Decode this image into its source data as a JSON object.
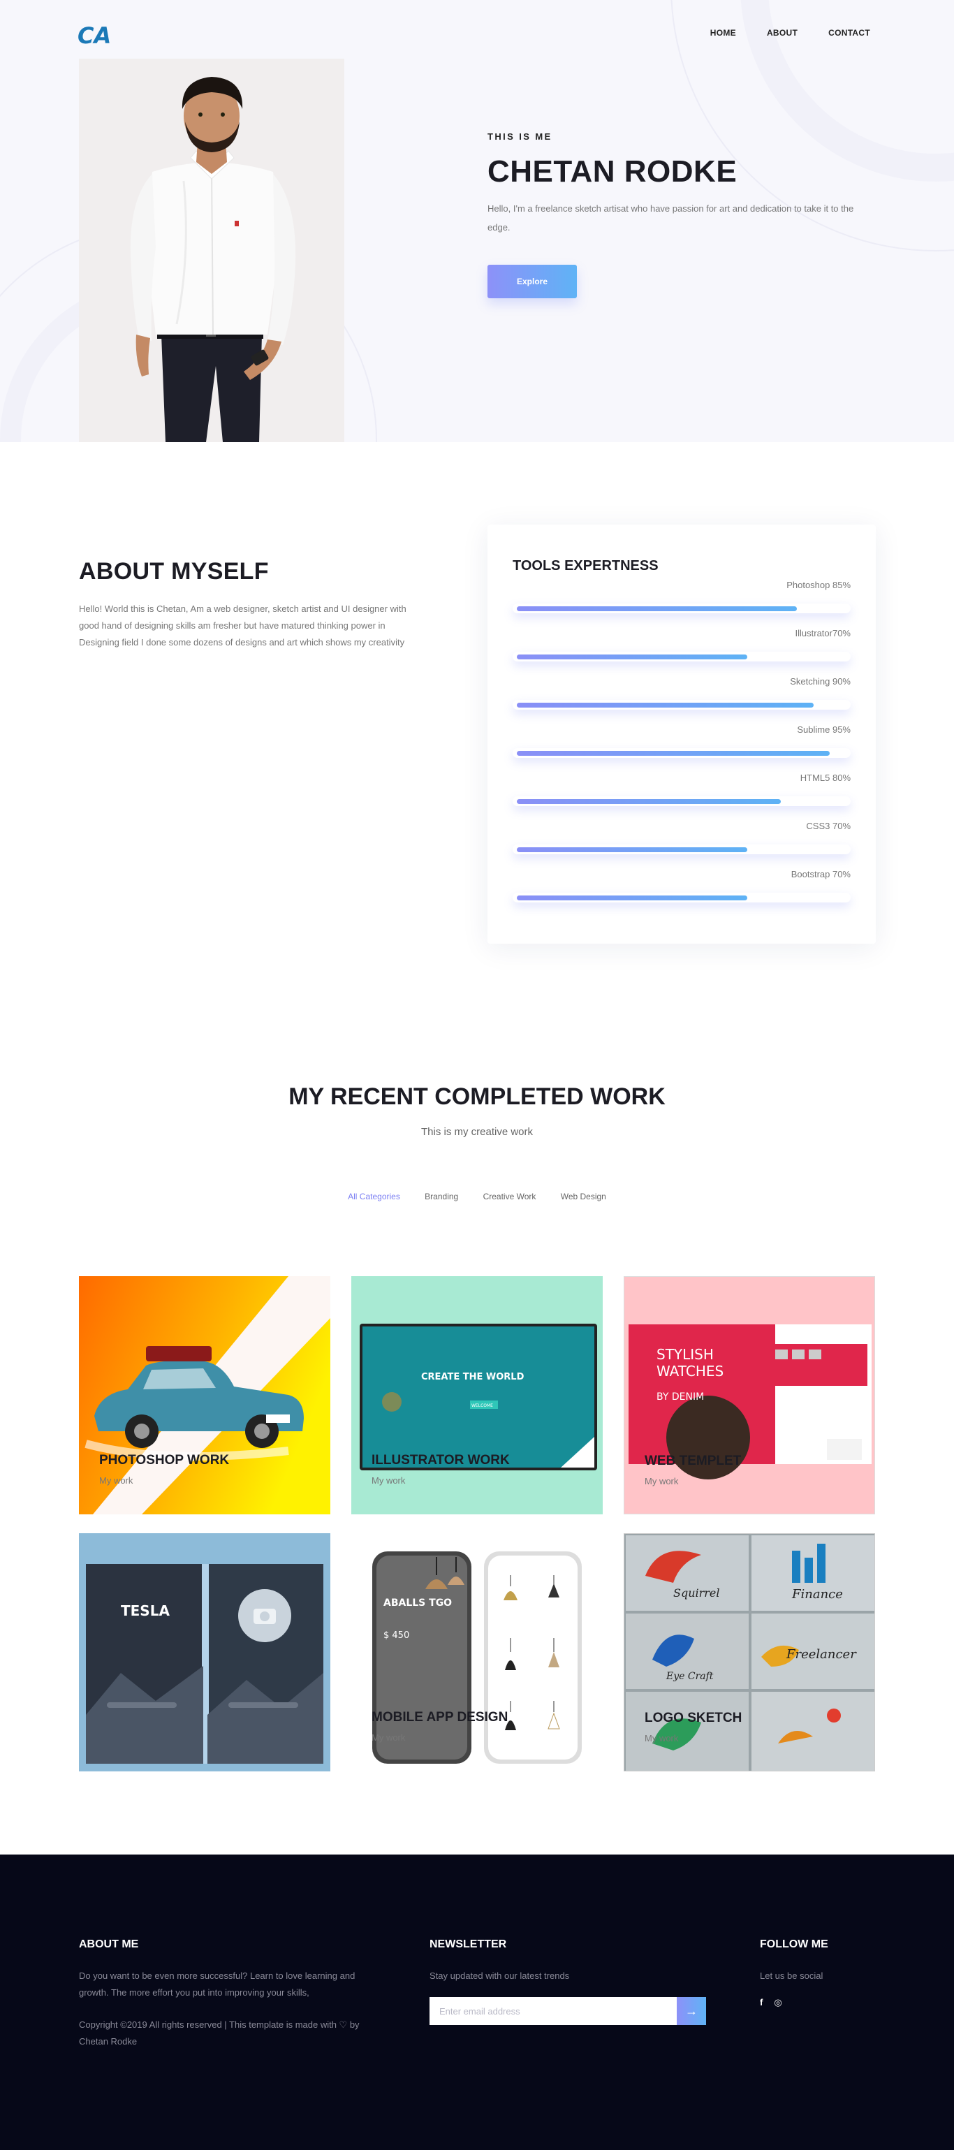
{
  "nav": {
    "logo_text": "CA",
    "items": [
      {
        "label": "HOME"
      },
      {
        "label": "ABOUT"
      },
      {
        "label": "CONTACT"
      }
    ]
  },
  "hero": {
    "eyebrow": "THIS IS ME",
    "title": "CHETAN RODKE",
    "description": "Hello, I'm a freelance sketch artisat who have passion for art and dedication to take it to the edge.",
    "button_label": "Explore"
  },
  "about": {
    "title": "ABOUT MYSELF",
    "description": "Hello! World this is Chetan, Am a web designer, sketch artist and UI designer with good hand of designing skills am fresher but have matured thinking power in Designing field I done some dozens of designs and art which shows my creativity"
  },
  "tools": {
    "title": "TOOLS EXPERTNESS",
    "skills": [
      {
        "label": "Photoshop 85%",
        "value": 85
      },
      {
        "label": "Illustrator70%",
        "value": 70
      },
      {
        "label": "Sketching 90%",
        "value": 90
      },
      {
        "label": "Sublime 95%",
        "value": 95
      },
      {
        "label": "HTML5 80%",
        "value": 80
      },
      {
        "label": "CSS3 70%",
        "value": 70
      },
      {
        "label": "Bootstrap 70%",
        "value": 70
      }
    ]
  },
  "work": {
    "title": "MY RECENT COMPLETED WORK",
    "subtitle": "This is my creative work",
    "filters": [
      {
        "label": "All Categories",
        "active": true
      },
      {
        "label": "Branding",
        "active": false
      },
      {
        "label": "Creative Work",
        "active": false
      },
      {
        "label": "Web Design",
        "active": false
      }
    ],
    "items": [
      {
        "title": "PHOTOSHOP WORK",
        "subtitle": "My work"
      },
      {
        "title": "ILLUSTRATOR WORK",
        "subtitle": "My work",
        "screen_heading": "CREATE THE WORLD",
        "screen_button": "WELCOME"
      },
      {
        "title": "WEB TEMPLET",
        "subtitle": "My work",
        "screen_text_1": "STYLISH",
        "screen_text_2": "WATCHES",
        "screen_text_3": "BY DENIM"
      },
      {
        "title": "",
        "subtitle": "",
        "screen_brand": "TESLA"
      },
      {
        "title": "MOBILE APP DESIGN",
        "subtitle": "My work",
        "screen_product": "ABALLS TGO",
        "screen_price": "$ 450"
      },
      {
        "title": "LOGO SKETCH",
        "subtitle": "My work",
        "sketch_words": [
          "Squirrel",
          "Finance",
          "Eye Craft",
          "Freelancer"
        ]
      }
    ]
  },
  "footer": {
    "about_title": "ABOUT ME",
    "about_text": "Do you want to be even more successful? Learn to love learning and growth. The more effort you put into improving your skills,",
    "copyright": "Copyright ©2019 All rights reserved | This template is made with ♡ by Chetan Rodke",
    "newsletter_title": "NEWSLETTER",
    "newsletter_text": "Stay updated with our latest trends",
    "newsletter_placeholder": "Enter email address",
    "newsletter_button": "→",
    "follow_title": "FOLLOW ME",
    "follow_text": "Let us be social",
    "social_icons": [
      {
        "name": "facebook-icon",
        "glyph": "f"
      },
      {
        "name": "instagram-icon",
        "glyph": "◎"
      }
    ]
  },
  "colors": {
    "accent_start": "#8d91f8",
    "accent_end": "#5fb3f6",
    "footer_bg": "#060818",
    "hero_bg": "#f7f7fc"
  }
}
